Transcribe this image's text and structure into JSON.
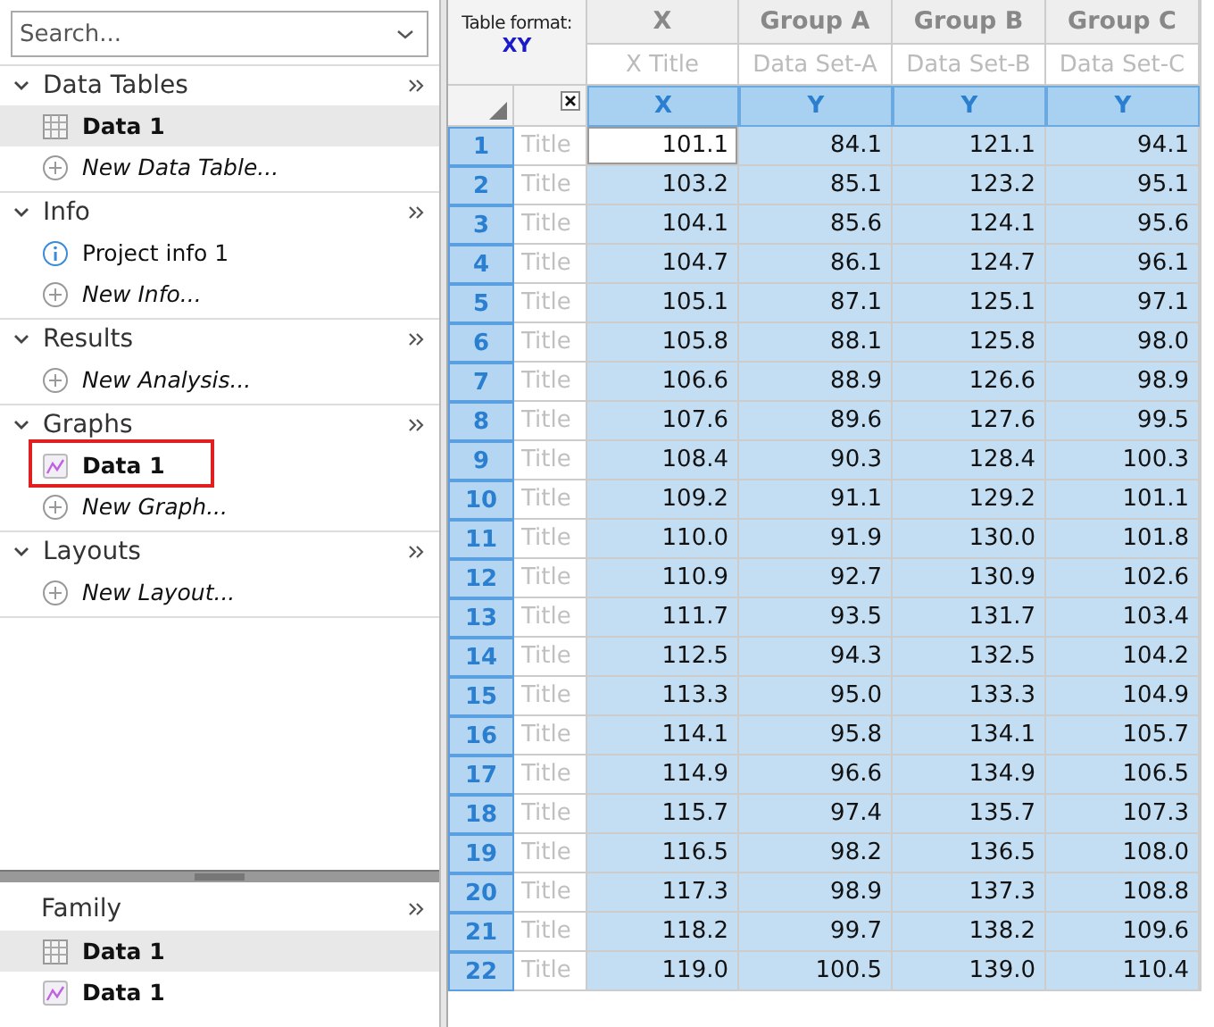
{
  "navigator": {
    "search": {
      "placeholder": "Search..."
    },
    "sections": [
      {
        "title": "Data Tables",
        "expanded": true,
        "items": [
          {
            "kind": "table",
            "label": "Data 1",
            "selected": true,
            "outlined": false
          },
          {
            "kind": "add",
            "label": "New Data Table...",
            "selected": false,
            "outlined": false
          }
        ]
      },
      {
        "title": "Info",
        "expanded": true,
        "items": [
          {
            "kind": "info",
            "label": "Project info 1",
            "selected": false,
            "outlined": false
          },
          {
            "kind": "add",
            "label": "New Info...",
            "selected": false,
            "outlined": false
          }
        ]
      },
      {
        "title": "Results",
        "expanded": true,
        "items": [
          {
            "kind": "add",
            "label": "New Analysis...",
            "selected": false,
            "outlined": false
          }
        ]
      },
      {
        "title": "Graphs",
        "expanded": true,
        "items": [
          {
            "kind": "graph",
            "label": "Data 1",
            "selected": false,
            "outlined": true
          },
          {
            "kind": "add",
            "label": "New Graph...",
            "selected": false,
            "outlined": false
          }
        ]
      },
      {
        "title": "Layouts",
        "expanded": true,
        "items": [
          {
            "kind": "add",
            "label": "New Layout...",
            "selected": false,
            "outlined": false
          }
        ]
      }
    ]
  },
  "family": {
    "title": "Family",
    "items": [
      {
        "kind": "table",
        "label": "Data 1",
        "selected": true
      },
      {
        "kind": "graph",
        "label": "Data 1",
        "selected": false
      }
    ]
  },
  "table": {
    "format_label": "Table format:",
    "format": "XY",
    "columns": [
      {
        "name": "X",
        "subtitle": "X Title",
        "type": "X"
      },
      {
        "name": "Group A",
        "subtitle": "Data Set-A",
        "type": "Y"
      },
      {
        "name": "Group B",
        "subtitle": "Data Set-B",
        "type": "Y"
      },
      {
        "name": "Group C",
        "subtitle": "Data Set-C",
        "type": "Y"
      }
    ],
    "rows": [
      {
        "number": "1",
        "title": "Title",
        "selected": true,
        "cells": [
          {
            "value": "101.1",
            "active": true
          },
          {
            "value": "84.1",
            "active": false
          },
          {
            "value": "121.1",
            "active": false
          },
          {
            "value": "94.1",
            "active": false
          }
        ]
      },
      {
        "number": "2",
        "title": "Title",
        "selected": true,
        "cells": [
          {
            "value": "103.2",
            "active": false
          },
          {
            "value": "85.1",
            "active": false
          },
          {
            "value": "123.2",
            "active": false
          },
          {
            "value": "95.1",
            "active": false
          }
        ]
      },
      {
        "number": "3",
        "title": "Title",
        "selected": true,
        "cells": [
          {
            "value": "104.1",
            "active": false
          },
          {
            "value": "85.6",
            "active": false
          },
          {
            "value": "124.1",
            "active": false
          },
          {
            "value": "95.6",
            "active": false
          }
        ]
      },
      {
        "number": "4",
        "title": "Title",
        "selected": true,
        "cells": [
          {
            "value": "104.7",
            "active": false
          },
          {
            "value": "86.1",
            "active": false
          },
          {
            "value": "124.7",
            "active": false
          },
          {
            "value": "96.1",
            "active": false
          }
        ]
      },
      {
        "number": "5",
        "title": "Title",
        "selected": true,
        "cells": [
          {
            "value": "105.1",
            "active": false
          },
          {
            "value": "87.1",
            "active": false
          },
          {
            "value": "125.1",
            "active": false
          },
          {
            "value": "97.1",
            "active": false
          }
        ]
      },
      {
        "number": "6",
        "title": "Title",
        "selected": true,
        "cells": [
          {
            "value": "105.8",
            "active": false
          },
          {
            "value": "88.1",
            "active": false
          },
          {
            "value": "125.8",
            "active": false
          },
          {
            "value": "98.0",
            "active": false
          }
        ]
      },
      {
        "number": "7",
        "title": "Title",
        "selected": true,
        "cells": [
          {
            "value": "106.6",
            "active": false
          },
          {
            "value": "88.9",
            "active": false
          },
          {
            "value": "126.6",
            "active": false
          },
          {
            "value": "98.9",
            "active": false
          }
        ]
      },
      {
        "number": "8",
        "title": "Title",
        "selected": true,
        "cells": [
          {
            "value": "107.6",
            "active": false
          },
          {
            "value": "89.6",
            "active": false
          },
          {
            "value": "127.6",
            "active": false
          },
          {
            "value": "99.5",
            "active": false
          }
        ]
      },
      {
        "number": "9",
        "title": "Title",
        "selected": true,
        "cells": [
          {
            "value": "108.4",
            "active": false
          },
          {
            "value": "90.3",
            "active": false
          },
          {
            "value": "128.4",
            "active": false
          },
          {
            "value": "100.3",
            "active": false
          }
        ]
      },
      {
        "number": "10",
        "title": "Title",
        "selected": true,
        "cells": [
          {
            "value": "109.2",
            "active": false
          },
          {
            "value": "91.1",
            "active": false
          },
          {
            "value": "129.2",
            "active": false
          },
          {
            "value": "101.1",
            "active": false
          }
        ]
      },
      {
        "number": "11",
        "title": "Title",
        "selected": true,
        "cells": [
          {
            "value": "110.0",
            "active": false
          },
          {
            "value": "91.9",
            "active": false
          },
          {
            "value": "130.0",
            "active": false
          },
          {
            "value": "101.8",
            "active": false
          }
        ]
      },
      {
        "number": "12",
        "title": "Title",
        "selected": true,
        "cells": [
          {
            "value": "110.9",
            "active": false
          },
          {
            "value": "92.7",
            "active": false
          },
          {
            "value": "130.9",
            "active": false
          },
          {
            "value": "102.6",
            "active": false
          }
        ]
      },
      {
        "number": "13",
        "title": "Title",
        "selected": true,
        "cells": [
          {
            "value": "111.7",
            "active": false
          },
          {
            "value": "93.5",
            "active": false
          },
          {
            "value": "131.7",
            "active": false
          },
          {
            "value": "103.4",
            "active": false
          }
        ]
      },
      {
        "number": "14",
        "title": "Title",
        "selected": true,
        "cells": [
          {
            "value": "112.5",
            "active": false
          },
          {
            "value": "94.3",
            "active": false
          },
          {
            "value": "132.5",
            "active": false
          },
          {
            "value": "104.2",
            "active": false
          }
        ]
      },
      {
        "number": "15",
        "title": "Title",
        "selected": true,
        "cells": [
          {
            "value": "113.3",
            "active": false
          },
          {
            "value": "95.0",
            "active": false
          },
          {
            "value": "133.3",
            "active": false
          },
          {
            "value": "104.9",
            "active": false
          }
        ]
      },
      {
        "number": "16",
        "title": "Title",
        "selected": true,
        "cells": [
          {
            "value": "114.1",
            "active": false
          },
          {
            "value": "95.8",
            "active": false
          },
          {
            "value": "134.1",
            "active": false
          },
          {
            "value": "105.7",
            "active": false
          }
        ]
      },
      {
        "number": "17",
        "title": "Title",
        "selected": true,
        "cells": [
          {
            "value": "114.9",
            "active": false
          },
          {
            "value": "96.6",
            "active": false
          },
          {
            "value": "134.9",
            "active": false
          },
          {
            "value": "106.5",
            "active": false
          }
        ]
      },
      {
        "number": "18",
        "title": "Title",
        "selected": true,
        "cells": [
          {
            "value": "115.7",
            "active": false
          },
          {
            "value": "97.4",
            "active": false
          },
          {
            "value": "135.7",
            "active": false
          },
          {
            "value": "107.3",
            "active": false
          }
        ]
      },
      {
        "number": "19",
        "title": "Title",
        "selected": true,
        "cells": [
          {
            "value": "116.5",
            "active": false
          },
          {
            "value": "98.2",
            "active": false
          },
          {
            "value": "136.5",
            "active": false
          },
          {
            "value": "108.0",
            "active": false
          }
        ]
      },
      {
        "number": "20",
        "title": "Title",
        "selected": true,
        "cells": [
          {
            "value": "117.3",
            "active": false
          },
          {
            "value": "98.9",
            "active": false
          },
          {
            "value": "137.3",
            "active": false
          },
          {
            "value": "108.8",
            "active": false
          }
        ]
      },
      {
        "number": "21",
        "title": "Title",
        "selected": true,
        "cells": [
          {
            "value": "118.2",
            "active": false
          },
          {
            "value": "99.7",
            "active": false
          },
          {
            "value": "138.2",
            "active": false
          },
          {
            "value": "109.6",
            "active": false
          }
        ]
      },
      {
        "number": "22",
        "title": "Title",
        "selected": true,
        "cells": [
          {
            "value": "119.0",
            "active": false
          },
          {
            "value": "100.5",
            "active": false
          },
          {
            "value": "139.0",
            "active": false
          },
          {
            "value": "110.4",
            "active": false
          }
        ]
      }
    ]
  }
}
